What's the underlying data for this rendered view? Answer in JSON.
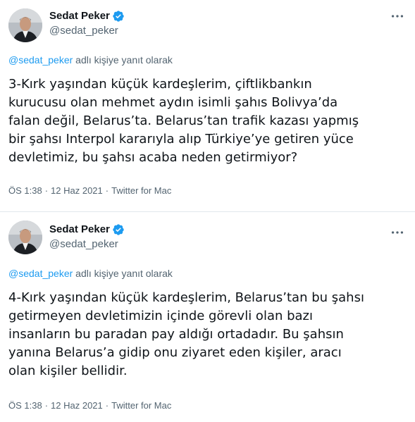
{
  "tweets": [
    {
      "author": {
        "display_name": "Sedat Peker",
        "handle": "@sedat_peker",
        "verified": true,
        "avatar_icon": "profile-photo"
      },
      "reply_context": {
        "mention": "@sedat_peker",
        "suffix": " adlı kişiye yanıt olarak"
      },
      "text_lines": [
        "3-Kırk yaşından küçük kardeşlerim, çiftlikbankın",
        "kurucusu olan mehmet aydın isimli şahıs Bolivya’da",
        "falan değil, Belarus’ta. Belarus’tan trafik kazası yapmış",
        "bir şahsı Interpol kararıyla alıp Türkiye’ye getiren yüce",
        "devletimiz, bu şahsı acaba neden getirmiyor?"
      ],
      "time": "ÖS 1:38",
      "date": "12 Haz 2021",
      "source": "Twitter for Mac"
    },
    {
      "author": {
        "display_name": "Sedat Peker",
        "handle": "@sedat_peker",
        "verified": true,
        "avatar_icon": "profile-photo"
      },
      "reply_context": {
        "mention": "@sedat_peker",
        "suffix": " adlı kişiye yanıt olarak"
      },
      "text_lines": [
        "4-Kırk yaşından küçük kardeşlerim, Belarus’tan bu şahsı",
        "getirmeyen devletimizin içinde görevli olan bazı",
        "insanların bu paradan pay aldığı ortadadır. Bu şahsın",
        "yanına Belarus’a gidip onu ziyaret eden kişiler, aracı",
        "olan kişiler bellidir."
      ],
      "time": "ÖS 1:38",
      "date": "12 Haz 2021",
      "source": "Twitter for Mac"
    }
  ],
  "meta_separator": "·",
  "colors": {
    "link": "#1d9bf0",
    "secondary_text": "#536471",
    "primary_text": "#0f1419",
    "verified_badge": "#1d9bf0",
    "divider": "#e1e8ed"
  }
}
